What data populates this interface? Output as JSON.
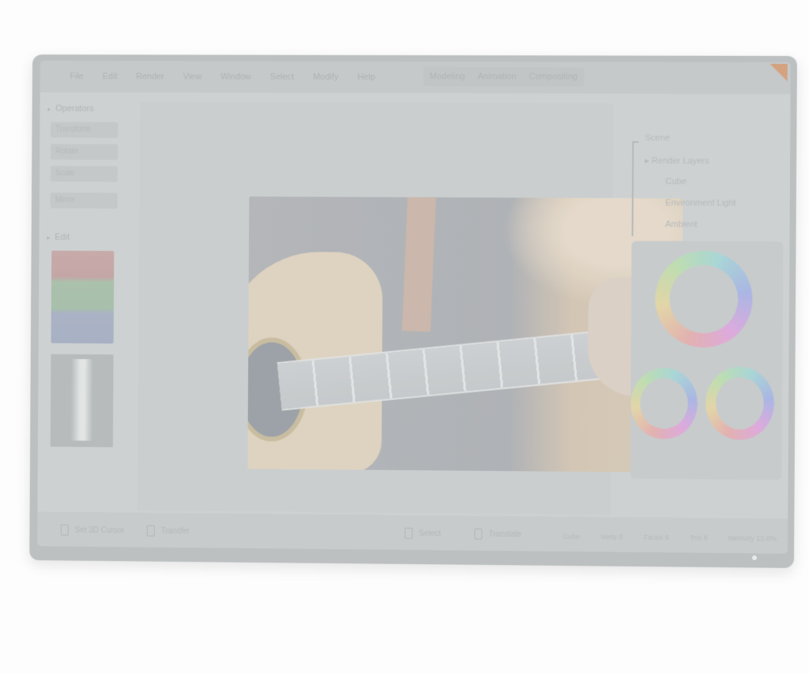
{
  "menu": {
    "items": [
      "File",
      "Edit",
      "Render",
      "View",
      "Window",
      "Select",
      "Modify",
      "Help"
    ]
  },
  "workspaces": {
    "tabs": [
      "Modeling",
      "Animation",
      "Compositing"
    ]
  },
  "left_panel": {
    "section_title": "Operators",
    "fields": [
      "Transform",
      "Rotate",
      "Scale",
      "Mirror"
    ],
    "section2_title": "Edit"
  },
  "outliner": {
    "title": "Scene",
    "items": [
      "Render Layers",
      "Cube",
      "Environment Light",
      "Ambient"
    ]
  },
  "footer": {
    "left_button": "Set 3D Cursor",
    "left_button2": "Transfer",
    "mid_button": "Select",
    "mid_button2": "Translate",
    "status_items": [
      "Cube",
      "Verts 8",
      "Faces 6",
      "Tris 8"
    ],
    "status_right": "Memory 12.0%"
  },
  "colors": {
    "accent_corner": "#d7a07a",
    "screen_bg": "#cfd3d4",
    "bezel": "#bcc0c1"
  },
  "icons": {
    "panel_toggle": "triangle-right-icon",
    "document": "document-icon"
  }
}
